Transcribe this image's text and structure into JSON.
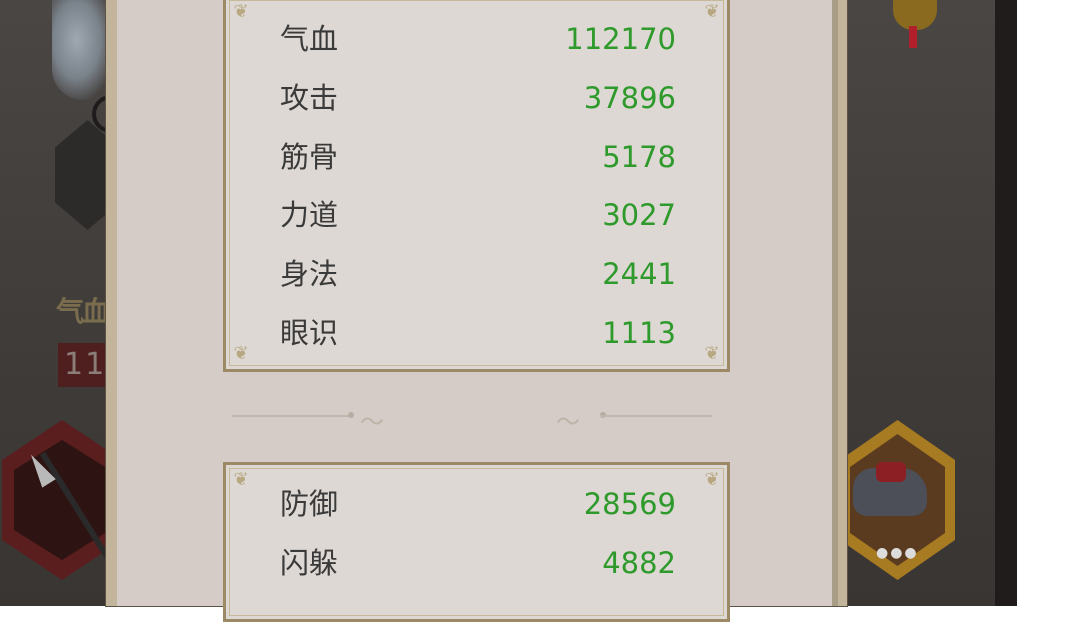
{
  "left_panel": {
    "stat_label": "气血",
    "stat_value_partial": "11"
  },
  "stats_primary": [
    {
      "name": "气血",
      "value": "112170"
    },
    {
      "name": "攻击",
      "value": "37896"
    },
    {
      "name": "筋骨",
      "value": "5178"
    },
    {
      "name": "力道",
      "value": "3027"
    },
    {
      "name": "身法",
      "value": "2441"
    },
    {
      "name": "眼识",
      "value": "1113"
    }
  ],
  "stats_secondary": [
    {
      "name": "防御",
      "value": "28569"
    },
    {
      "name": "闪躲",
      "value": "4882"
    }
  ],
  "colors": {
    "stat_value": "#2e9a2b",
    "stat_name": "#3a3a3a",
    "panel_frame": "#9c8a66",
    "panel_fill": "#ddd8d3"
  },
  "icons": {
    "weapon_slot": "spear-icon",
    "mount_slot": "elephant-mount-icon",
    "ornament": "hanging-ornament-icon"
  }
}
